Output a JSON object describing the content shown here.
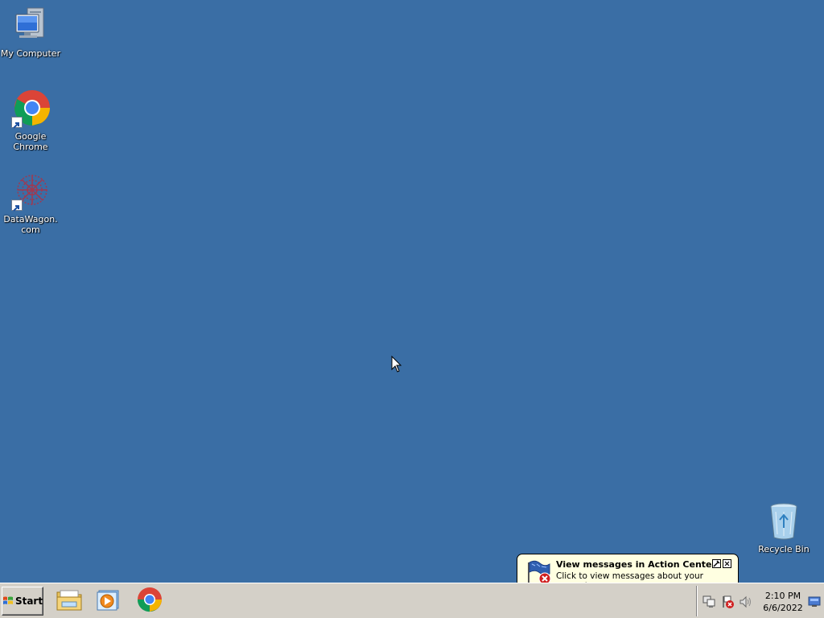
{
  "desktop": {
    "background_color": "#3a6ea5",
    "icons": [
      {
        "label": "My Computer",
        "icon": "computer-icon"
      },
      {
        "label": "Google Chrome",
        "icon": "chrome-icon",
        "shortcut": true
      },
      {
        "label": "DataWagon.com",
        "icon": "datawagon-icon",
        "shortcut": true
      },
      {
        "label": "Recycle Bin",
        "icon": "recycle-bin-icon"
      }
    ]
  },
  "taskbar": {
    "start_label": "Start",
    "quick_launch": [
      {
        "name": "Windows Explorer",
        "icon": "folder-icon"
      },
      {
        "name": "Windows Media Player",
        "icon": "media-player-icon"
      },
      {
        "name": "Google Chrome",
        "icon": "chrome-icon"
      }
    ],
    "tray": {
      "icons": [
        "network-icon",
        "action-center-icon",
        "volume-icon"
      ],
      "time": "2:10 PM",
      "date": "6/6/2022"
    }
  },
  "balloon": {
    "title": "View messages in Action Center",
    "text": "Click to view messages about your computer."
  },
  "colors": {
    "desktop": "#3a6ea5",
    "taskbar": "#d4d0c8",
    "balloon": "#ffffe1"
  }
}
